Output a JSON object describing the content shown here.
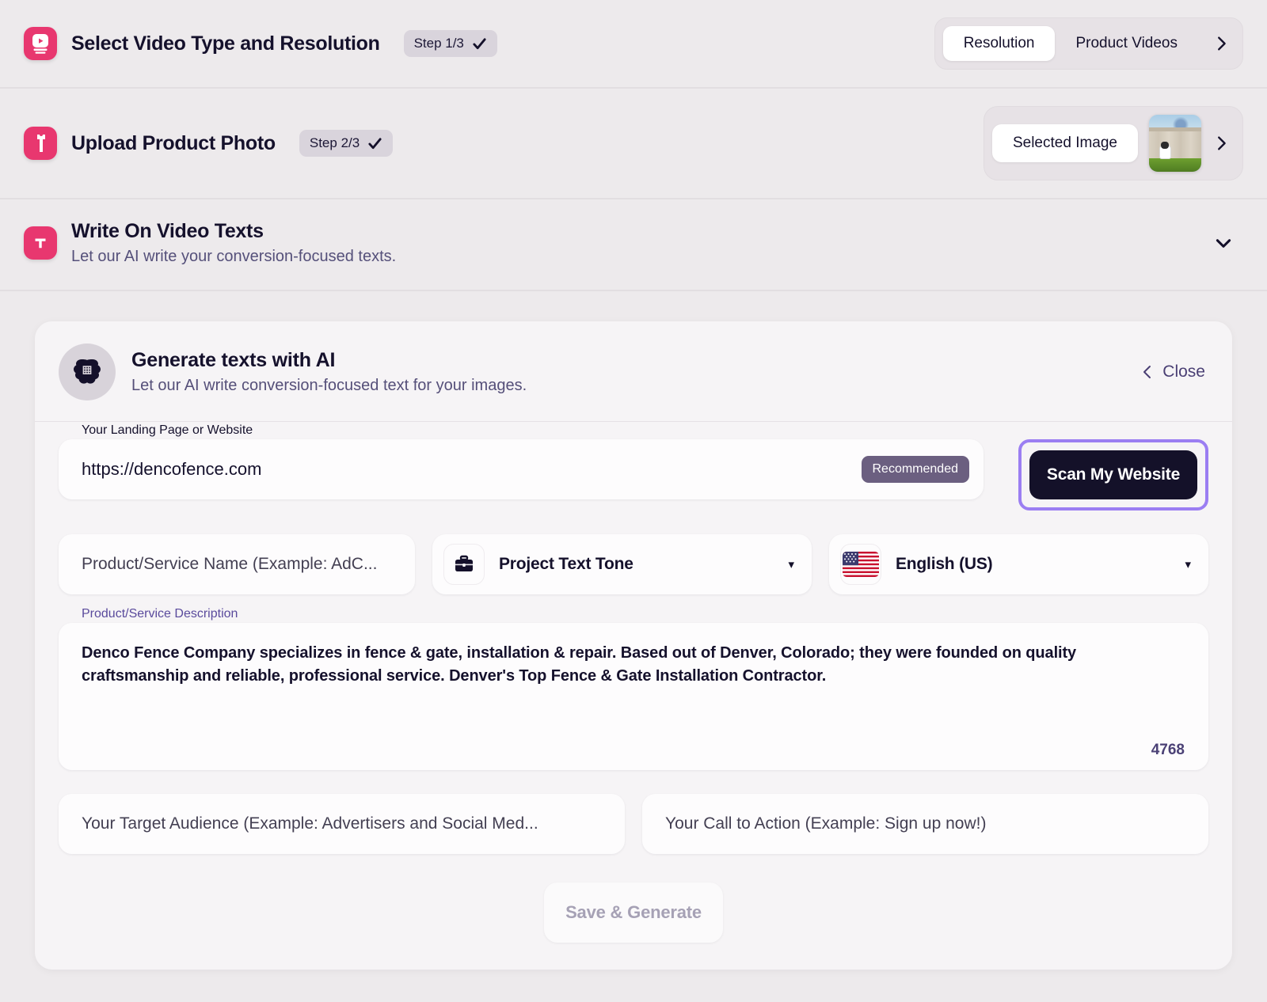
{
  "steps": [
    {
      "icon": "video-play-icon",
      "title": "Select Video Type and Resolution",
      "badge": "Step 1/3",
      "toggle_options": [
        "Resolution",
        "Product Videos"
      ],
      "toggle_selected": "Resolution",
      "expand_icon": "chevron-right-icon"
    },
    {
      "icon": "product-shirt-icon",
      "title": "Upload Product Photo",
      "badge": "Step 2/3",
      "selected_image_label": "Selected Image",
      "thumbnail_alt": "white fence with dog on grass",
      "expand_icon": "chevron-right-icon"
    },
    {
      "icon": "text-t-icon",
      "title": "Write On Video Texts",
      "subtitle": "Let our AI write your conversion-focused texts.",
      "collapse_icon": "chevron-down-icon"
    }
  ],
  "ai_panel": {
    "icon": "brain-icon",
    "title": "Generate texts with AI",
    "subtitle": "Let our AI write conversion-focused text for your images.",
    "close_label": "Close",
    "close_icon": "chevron-left-icon",
    "url_field": {
      "label": "Your Landing Page or Website",
      "value": "https://dencofence.com",
      "badge": "Recommended"
    },
    "scan_button": {
      "label": "Scan My Website",
      "highlight_color": "#9b7ef2",
      "background_color": "#141129"
    },
    "product_name_field": {
      "placeholder": "Product/Service Name (Example: AdC..."
    },
    "tone_select": {
      "icon": "briefcase-icon",
      "value": "Project Text Tone",
      "caret": "▾"
    },
    "language_select": {
      "icon": "us-flag-icon",
      "value": "English (US)",
      "caret": "▾"
    },
    "description_field": {
      "label": "Product/Service Description",
      "value": "Denco Fence Company specializes in fence & gate, installation & repair. Based out of Denver, Colorado; they were founded on quality craftsmanship and reliable, professional service. Denver's Top Fence & Gate Installation Contractor.",
      "counter": "4768"
    },
    "target_audience_field": {
      "placeholder": "Your Target Audience (Example: Advertisers and Social Med..."
    },
    "cta_field": {
      "placeholder": "Your Call to Action (Example: Sign up now!)"
    },
    "save_button": {
      "label": "Save & Generate",
      "disabled": true
    }
  },
  "colors": {
    "brand_pink": "#e8376f",
    "page_bg": "#edeaec",
    "dark": "#141129",
    "purple_accent": "#9b7ef2"
  }
}
